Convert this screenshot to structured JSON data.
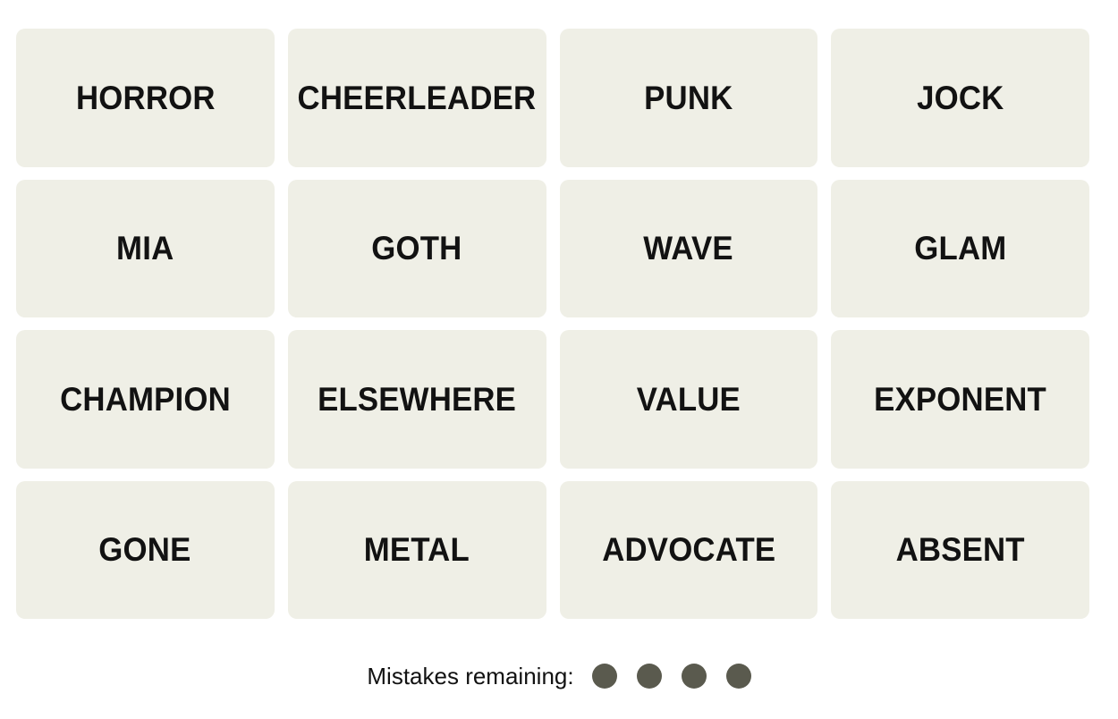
{
  "game": {
    "name": "Connections",
    "board_colors": {
      "page_background": "#FFFFFF",
      "tile_background": "#EFEFE6",
      "tile_text": "#121212",
      "mistake_dot": "#5A5A4E"
    }
  },
  "grid": {
    "columns": 4,
    "rows": 4,
    "tiles": [
      {
        "label": "HORROR"
      },
      {
        "label": "CHEERLEADER"
      },
      {
        "label": "PUNK"
      },
      {
        "label": "JOCK"
      },
      {
        "label": "MIA"
      },
      {
        "label": "GOTH"
      },
      {
        "label": "WAVE"
      },
      {
        "label": "GLAM"
      },
      {
        "label": "CHAMPION"
      },
      {
        "label": "ELSEWHERE"
      },
      {
        "label": "VALUE"
      },
      {
        "label": "EXPONENT"
      },
      {
        "label": "GONE"
      },
      {
        "label": "METAL"
      },
      {
        "label": "ADVOCATE"
      },
      {
        "label": "ABSENT"
      }
    ]
  },
  "mistakes": {
    "label": "Mistakes remaining:",
    "remaining": 4,
    "dots": [
      1,
      2,
      3,
      4
    ]
  }
}
